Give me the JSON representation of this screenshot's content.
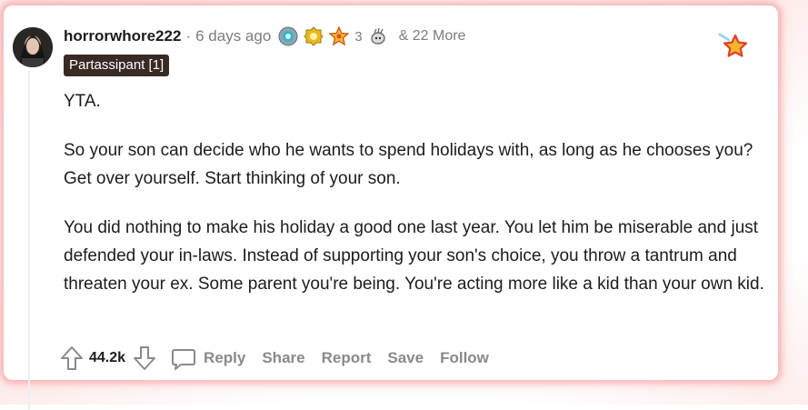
{
  "comment": {
    "author": "horrorwhore222",
    "separator": "·",
    "timestamp": "6 days ago",
    "awards": [
      {
        "icon": "silver-helmet-award-icon"
      },
      {
        "icon": "gold-badge-award-icon"
      },
      {
        "icon": "wholesome-star-award-icon",
        "count": "3"
      },
      {
        "icon": "hand-award-icon"
      }
    ],
    "more_awards": "& 22 More",
    "flair": "Partassipant [1]",
    "paragraphs": [
      "YTA.",
      "So your son can decide who he wants to spend holidays with, as long as he chooses you? Get over yourself. Start thinking of your son.",
      "You did nothing to make his holiday a good one last year. You let him be miserable and just defended your in-laws. Instead of supporting your son's choice, you throw a tantrum and threaten your ex. Some parent you're being. You're acting more like a kid than your own kid."
    ],
    "score": "44.2k",
    "actions": {
      "reply": "Reply",
      "share": "Share",
      "report": "Report",
      "save": "Save",
      "follow": "Follow"
    }
  },
  "colors": {
    "text": "#1c1c1c",
    "muted": "#7c7c7c",
    "action": "#878a8c",
    "flair_bg": "#3a2a24",
    "card_glow": "#f59696"
  }
}
